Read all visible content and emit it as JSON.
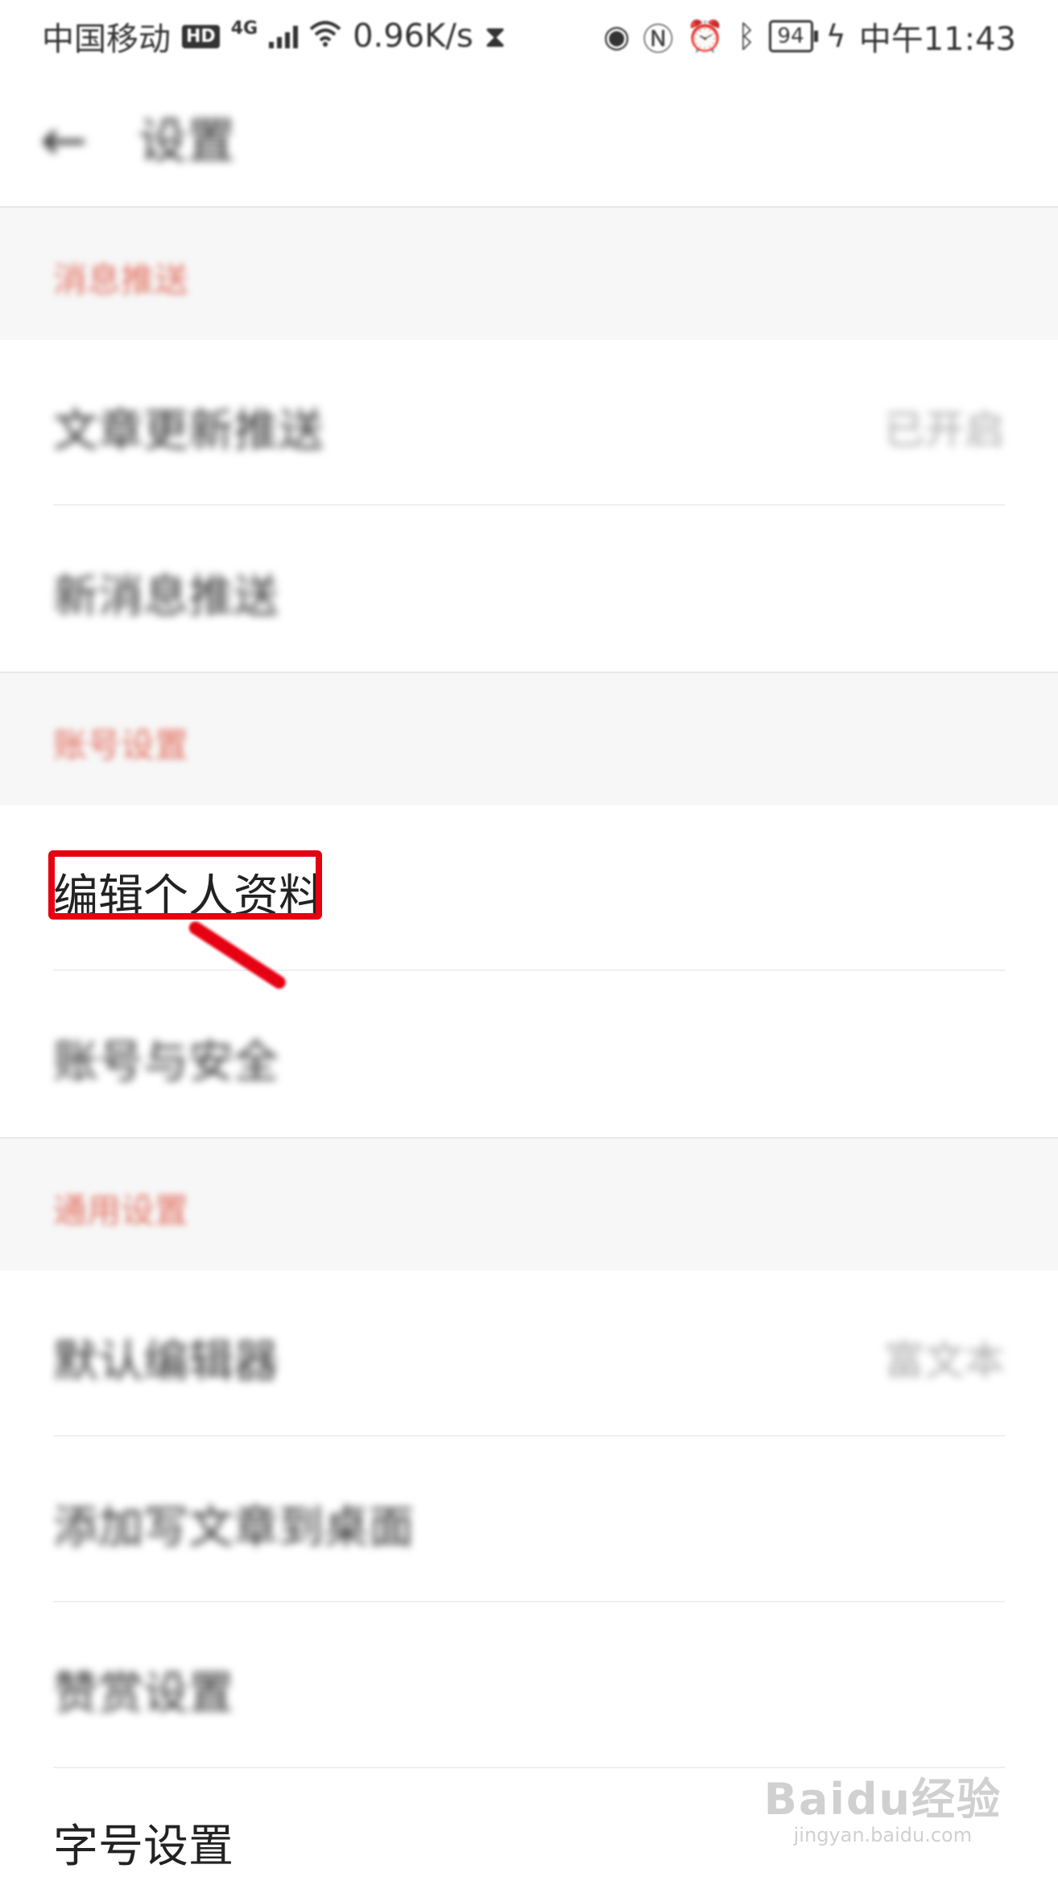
{
  "status_bar": {
    "carrier": "中国移动",
    "hd_badge": "HD",
    "network_type": "4G",
    "speed": "0.96K/s",
    "battery": "94",
    "time": "中午11:43",
    "icons": [
      "signal-icon",
      "wifi-icon",
      "hourglass-icon",
      "eye-icon",
      "nfc-icon",
      "alarm-icon",
      "bluetooth-icon",
      "vibrate-icon",
      "battery-icon",
      "charging-icon"
    ]
  },
  "header": {
    "back_icon": "back-arrow-icon",
    "title": "设置"
  },
  "sections": [
    {
      "label": "消息推送",
      "rows": [
        {
          "label": "文章更新推送",
          "value": "已开启"
        },
        {
          "label": "新消息推送",
          "value": ""
        }
      ]
    },
    {
      "label": "账号设置",
      "rows": [
        {
          "label": "编辑个人资料",
          "value": ""
        },
        {
          "label": "账号与安全",
          "value": ""
        }
      ]
    },
    {
      "label": "通用设置",
      "rows": [
        {
          "label": "默认编辑器",
          "value": "富文本"
        },
        {
          "label": "添加写文章到桌面",
          "value": ""
        },
        {
          "label": "赞赏设置",
          "value": ""
        },
        {
          "label": "字号设置",
          "value": ""
        }
      ]
    }
  ],
  "annotation": {
    "highlight_color": "#e60012",
    "target": "编辑个人资料"
  },
  "watermark": {
    "logo": "Baidu经验",
    "url": "jingyan.baidu.com"
  },
  "colors": {
    "section_label": "#e27060",
    "section_bg": "#f7f7f7",
    "highlight": "#e60012"
  }
}
